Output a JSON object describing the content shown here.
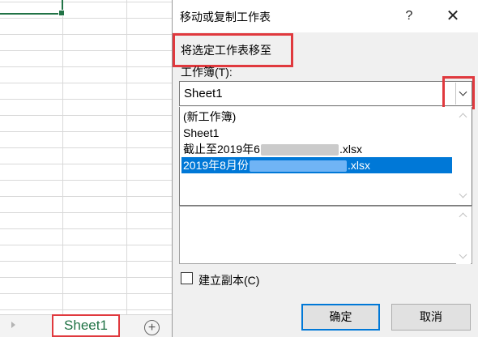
{
  "spreadsheet": {
    "sheet_tab": "Sheet1",
    "add_sheet_icon": "plus-circle-icon"
  },
  "dialog": {
    "title": "移动或复制工作表",
    "help": "?",
    "close": "✕",
    "move_to_label": "将选定工作表移至",
    "workbook_label": "工作簿(T):",
    "workbook_value": "Sheet1",
    "workbook_options": [
      {
        "text": "(新工作簿)"
      },
      {
        "text": "Sheet1"
      },
      {
        "prefix": "截止至2019年6",
        "suffix": ".xlsx"
      },
      {
        "prefix": "2019年8月份",
        "suffix": ".xlsx",
        "selected": true
      }
    ],
    "copy_checkbox_label": "建立副本(C)",
    "copy_checked": false,
    "ok_label": "确定",
    "cancel_label": "取消"
  },
  "colors": {
    "selection": "#0078d7",
    "highlight": "#e0393e",
    "excel_green": "#217346"
  }
}
